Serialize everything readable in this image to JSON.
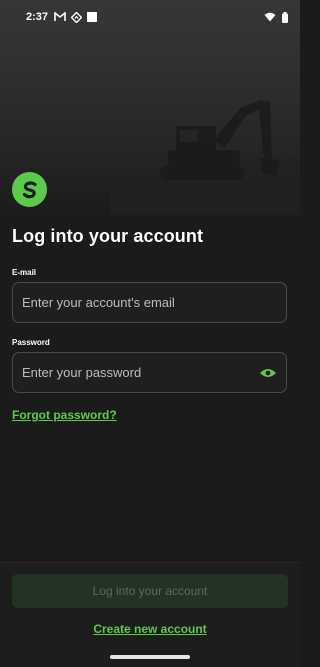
{
  "status_bar": {
    "time": "2:37",
    "left_icons": [
      "gmail-icon",
      "location-diamond-icon",
      "square-notification-icon"
    ],
    "right_icons": [
      "wifi-icon",
      "battery-icon"
    ]
  },
  "hero": {
    "image": "excavator-silhouette"
  },
  "logo": {
    "icon": "brand-s-logo-icon",
    "color": "#5dcb4a"
  },
  "page": {
    "title": "Log into your account"
  },
  "form": {
    "email_label": "E-mail",
    "email_placeholder": "Enter your account's email",
    "email_value": "",
    "password_label": "Password",
    "password_placeholder": "Enter your password",
    "password_value": "",
    "visibility_icon": "eye-icon",
    "forgot_link": "Forgot password?"
  },
  "actions": {
    "login_button": "Log into your account",
    "create_account_link": "Create new account"
  },
  "colors": {
    "accent": "#5dcb4a",
    "background": "#1b1b1b",
    "disabled_button": "#233323"
  }
}
